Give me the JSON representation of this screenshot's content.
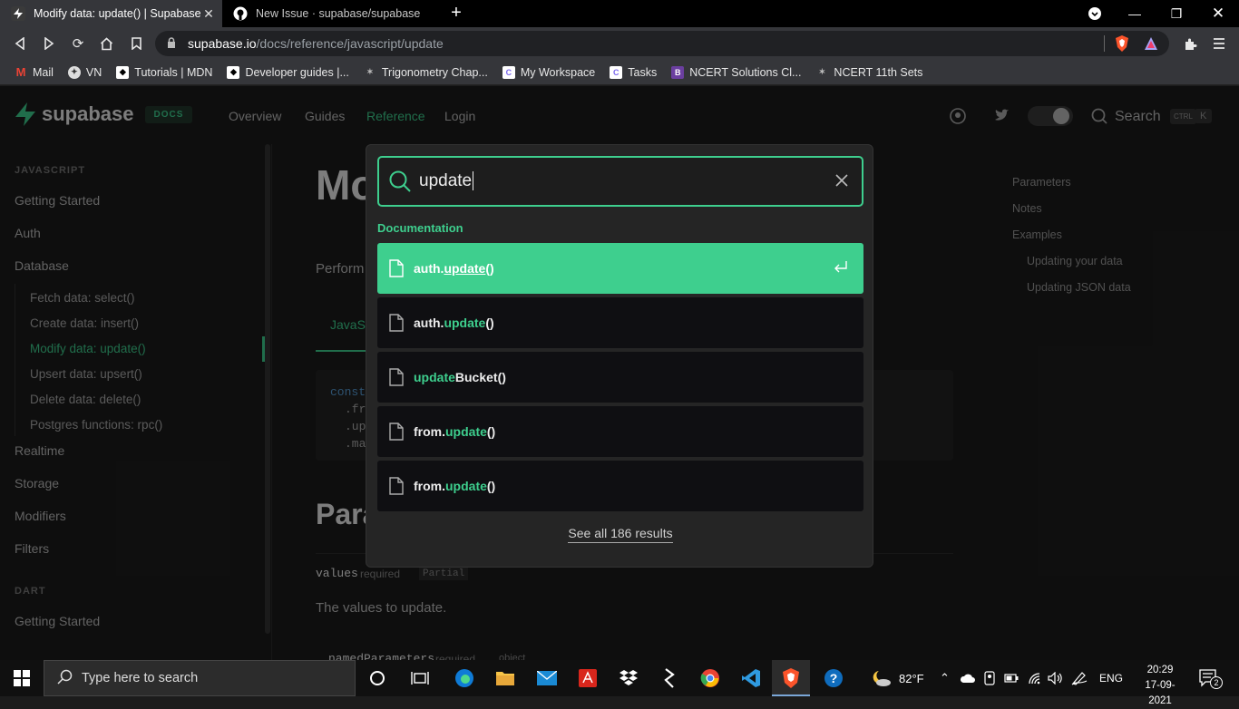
{
  "browser": {
    "tabs": [
      {
        "title": "Modify data: update() | Supabase",
        "active": true
      },
      {
        "title": "New Issue · supabase/supabase",
        "active": false
      }
    ],
    "url_host": "supabase.io",
    "url_path": "/docs/reference/javascript/update",
    "bookmarks": [
      {
        "label": "Mail",
        "icon": "gmail-icon"
      },
      {
        "label": "VN",
        "icon": "vn-icon"
      },
      {
        "label": "Tutorials | MDN",
        "icon": "mdn-icon"
      },
      {
        "label": "Developer guides |...",
        "icon": "mdn-icon"
      },
      {
        "label": "Trigonometry Chap...",
        "icon": "bookmark-icon"
      },
      {
        "label": "My Workspace",
        "icon": "clickup-icon"
      },
      {
        "label": "Tasks",
        "icon": "clickup-icon"
      },
      {
        "label": "NCERT Solutions Cl...",
        "icon": "b-icon"
      },
      {
        "label": "NCERT 11th Sets",
        "icon": "bookmark-icon"
      }
    ]
  },
  "page": {
    "brand": "supabase",
    "docs_badge": "DOCS",
    "nav": [
      "Overview",
      "Guides",
      "Reference",
      "Login"
    ],
    "header_search": "Search",
    "kbd": [
      "CTRL",
      "K"
    ],
    "sidebar": {
      "section1": "JAVASCRIPT",
      "getting_started": "Getting Started",
      "auth": "Auth",
      "database": "Database",
      "db_items": [
        "Fetch data: select()",
        "Create data: insert()",
        "Modify data: update()",
        "Upsert data: upsert()",
        "Delete data: delete()",
        "Postgres functions: rpc()"
      ],
      "realtime": "Realtime",
      "storage": "Storage",
      "modifiers": "Modifiers",
      "filters": "Filters",
      "section2": "DART",
      "getting_started2": "Getting Started"
    },
    "content": {
      "title_partial": "Mo",
      "intro_partial": "Perform",
      "tab_partial": "JavaS",
      "code_lines": [
        "const",
        ".fr",
        ".up",
        ".ma"
      ],
      "params_partial": "Para",
      "param_name": "values",
      "param_required": "required",
      "param_type": "Partial",
      "param_desc": "The values to update.",
      "param2_name": "namedParameters",
      "param2_required": "required",
      "param2_type": "object"
    },
    "toc": [
      "Parameters",
      "Notes",
      "Examples",
      "Updating your data",
      "Updating JSON data"
    ]
  },
  "search_modal": {
    "query": "update",
    "section_label": "Documentation",
    "results": [
      {
        "prefix": "auth.",
        "match": "update",
        "suffix": "()",
        "selected": true
      },
      {
        "prefix": "auth.",
        "match": "update",
        "suffix": "()",
        "selected": false
      },
      {
        "prefix": "",
        "match": "update",
        "suffix": "Bucket()",
        "selected": false
      },
      {
        "prefix": "from.",
        "match": "update",
        "suffix": "()",
        "selected": false
      },
      {
        "prefix": "from.",
        "match": "update",
        "suffix": "()",
        "selected": false
      }
    ],
    "see_all": "See all 186 results"
  },
  "taskbar": {
    "search_placeholder": "Type here to search",
    "weather": "82°F",
    "language": "ENG",
    "time": "20:29",
    "date": "17-09-2021",
    "notifications": "2"
  },
  "colors": {
    "accent": "#3ecf8e",
    "modal_bg": "#252525",
    "result_bg": "#0f0f12"
  }
}
